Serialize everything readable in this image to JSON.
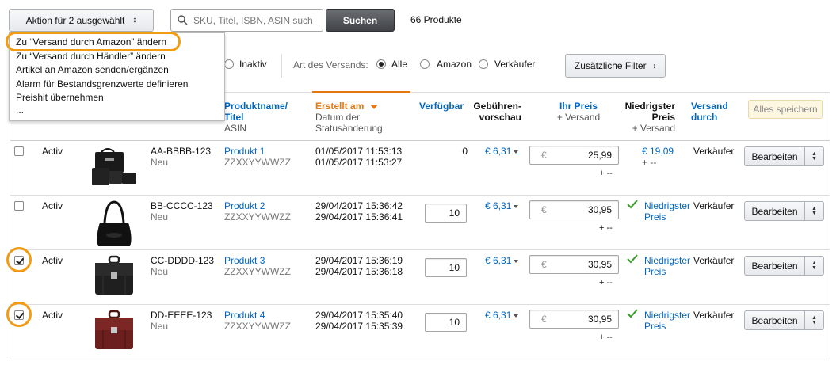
{
  "toolbar": {
    "action_label": "Aktion für 2 ausgewählt",
    "search_placeholder": "SKU, Titel, ISBN, ASIN such",
    "search_button": "Suchen",
    "product_count": "66 Produkte"
  },
  "action_menu": {
    "items": [
      "Zu “Versand durch Amazon” ändern",
      "Zu “Versand durch Händler” ändern",
      "Artikel an Amazon senden/ergänzen",
      "Alarm für Bestandsgrenzwerte definieren",
      "Preishit übernehmen",
      "..."
    ]
  },
  "filters": {
    "inaktiv": "Inaktiv",
    "shipping_label": "Art des Versands:",
    "options": [
      "Alle",
      "Amazon",
      "Verkäufer"
    ],
    "selected": "Alle",
    "more_filters": "Zusätzliche Filter"
  },
  "headers": {
    "product_name": "Produktname/",
    "product_title": "Titel",
    "asin": "ASIN",
    "created": "Erstellt am",
    "status_date_1": "Datum der",
    "status_date_2": "Statusänderung",
    "available": "Verfügbar",
    "fee_1": "Gebühren-",
    "fee_2": "vorschau",
    "your_price": "Ihr Preis",
    "plus_shipping": "+ Versand",
    "lowest_1": "Niedrigster",
    "lowest_2": "Preis",
    "lowest_3": "+ Versand",
    "fulfilled_1": "Versand",
    "fulfilled_2": "durch",
    "save_all": "Alles speichern"
  },
  "rows": [
    {
      "checked": false,
      "status": "Activ",
      "sku": "AA-BBBB-123",
      "condition": "Neu",
      "name": "Produkt 1",
      "asin": "ZZXXYYWWZZ",
      "created": "01/05/2017 11:53:13",
      "changed": "01/05/2017 11:53:27",
      "available": "0",
      "fee": "€ 6,31",
      "currency": "€",
      "price": "25,99",
      "price_shipping": "+ --",
      "lowest_price": "€ 19,09",
      "lowest_shipping": "+ --",
      "lowest_is_you": false,
      "fulfilled": "Verkäufer",
      "edit": "Bearbeiten"
    },
    {
      "checked": false,
      "status": "Activ",
      "sku": "BB-CCCC-123",
      "condition": "Neu",
      "name": "Produkt 2",
      "asin": "ZZXXYYWWZZ",
      "created": "29/04/2017 15:36:42",
      "changed": "29/04/2017 15:36:41",
      "available": "10",
      "fee": "€ 6,31",
      "currency": "€",
      "price": "30,95",
      "price_shipping": "+ --",
      "lowest_1": "Niedrigster",
      "lowest_2": "Preis",
      "lowest_is_you": true,
      "fulfilled": "Verkäufer",
      "edit": "Bearbeiten"
    },
    {
      "checked": true,
      "status": "Activ",
      "sku": "CC-DDDD-123",
      "condition": "Neu",
      "name": "Produkt 3",
      "asin": "ZZXXYYWWZZ",
      "created": "29/04/2017 15:36:19",
      "changed": "29/04/2017 15:36:18",
      "available": "10",
      "fee": "€ 6,31",
      "currency": "€",
      "price": "30,95",
      "price_shipping": "+ --",
      "lowest_1": "Niedrigster",
      "lowest_2": "Preis",
      "lowest_is_you": true,
      "fulfilled": "Verkäufer",
      "edit": "Bearbeiten"
    },
    {
      "checked": true,
      "status": "Activ",
      "sku": "DD-EEEE-123",
      "condition": "Neu",
      "name": "Produkt 4",
      "asin": "ZZXXYYWWZZ",
      "created": "29/04/2017 15:35:40",
      "changed": "29/04/2017 15:35:39",
      "available": "10",
      "fee": "€ 6,31",
      "currency": "€",
      "price": "30,95",
      "price_shipping": "+ --",
      "lowest_1": "Niedrigster",
      "lowest_2": "Preis",
      "lowest_is_you": true,
      "fulfilled": "Verkäufer",
      "edit": "Bearbeiten"
    }
  ],
  "colors": {
    "link": "#0066c0",
    "sort_active": "#e47911",
    "highlight_ring": "#f39c12",
    "check_green": "#3a9a2a"
  }
}
